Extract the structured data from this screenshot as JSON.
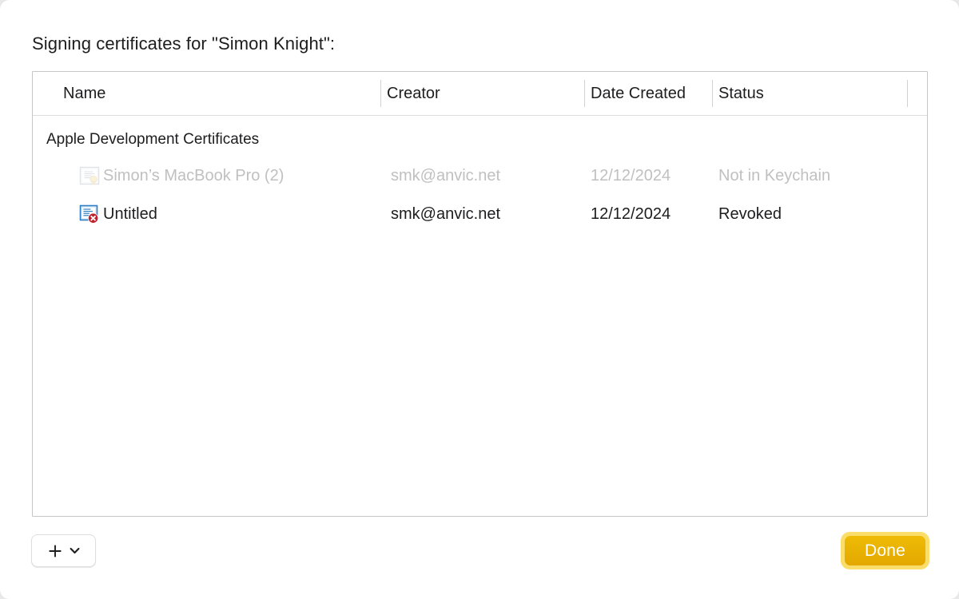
{
  "dialog": {
    "title": "Signing certificates for \"Simon Knight\":"
  },
  "table": {
    "columns": [
      {
        "key": "name",
        "label": "Name"
      },
      {
        "key": "creator",
        "label": "Creator"
      },
      {
        "key": "date",
        "label": "Date Created"
      },
      {
        "key": "status",
        "label": "Status"
      }
    ],
    "groups": [
      {
        "label": "Apple Development Certificates",
        "rows": [
          {
            "icon": "certificate-icon",
            "name": "Simon’s MacBook Pro (2)",
            "creator": "smk@anvic.net",
            "date": "12/12/2024",
            "status": "Not in Keychain",
            "enabled": false
          },
          {
            "icon": "certificate-revoked-icon",
            "name": "Untitled",
            "creator": "smk@anvic.net",
            "date": "12/12/2024",
            "status": "Revoked",
            "enabled": true
          }
        ]
      }
    ]
  },
  "footer": {
    "add_button": {
      "plus_icon": "plus-icon",
      "chevron_icon": "chevron-down-icon"
    },
    "done_button": {
      "label": "Done"
    }
  },
  "colors": {
    "accent": "#e8b200",
    "focus_ring": "#fbdd6a",
    "text": "#1d1d1f",
    "text_disabled": "#c0c0c0",
    "revoked_badge": "#c0222b"
  }
}
